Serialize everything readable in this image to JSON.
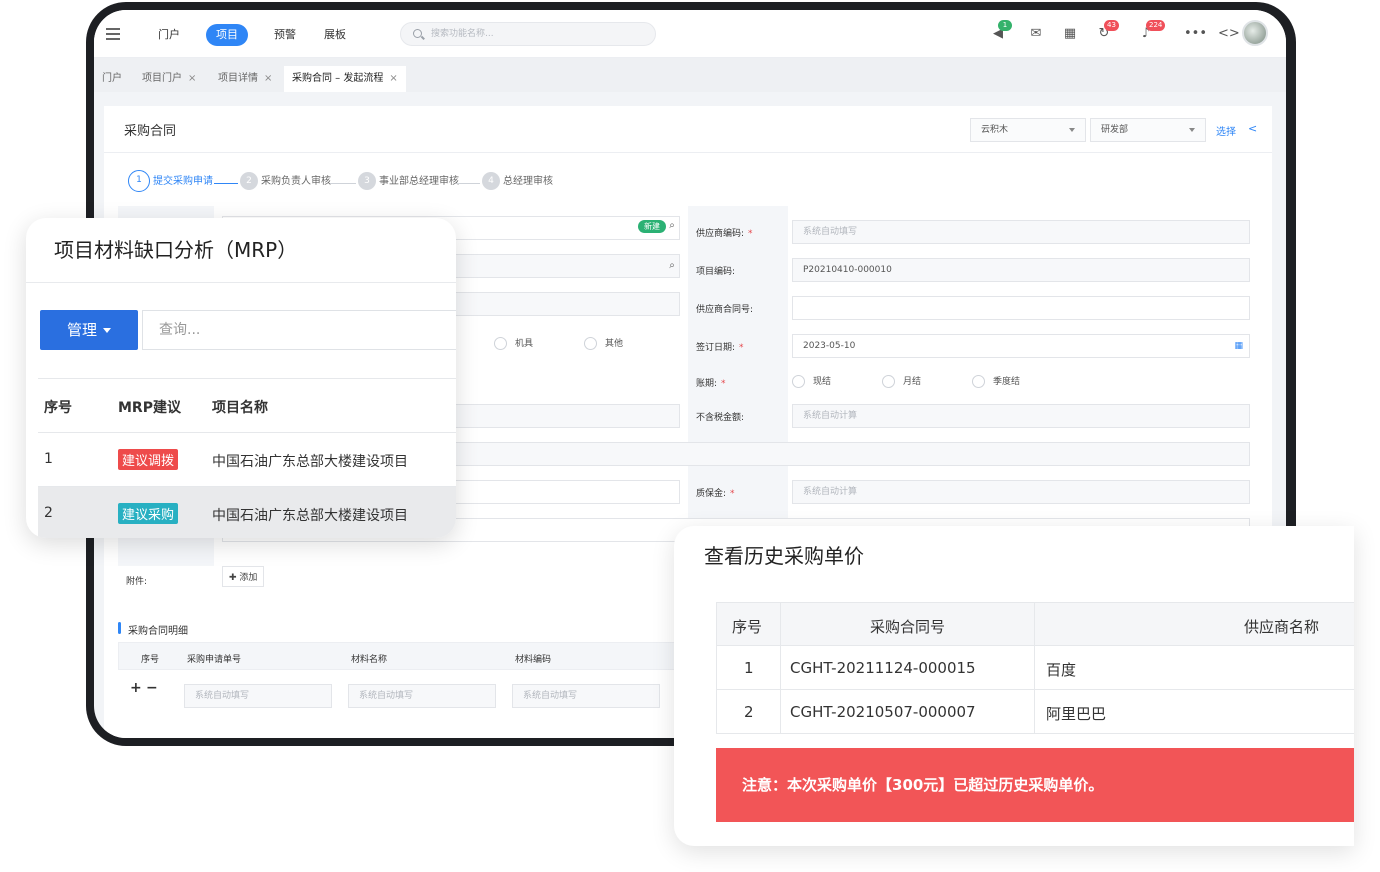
{
  "nav": {
    "items": [
      "门户",
      "项目",
      "预警",
      "展板"
    ],
    "active_index": 1,
    "search_placeholder": "搜索功能名称..."
  },
  "header_icons": {
    "announce_badge": "1",
    "refresh_badge": "43",
    "bell_badge": "224",
    "more": "•••",
    "code": "<>"
  },
  "tabs": [
    {
      "label": "门户",
      "closable": false
    },
    {
      "label": "项目门户",
      "closable": true
    },
    {
      "label": "项目详情",
      "closable": true
    },
    {
      "label": "采购合同 – 发起流程",
      "closable": true,
      "active": true
    }
  ],
  "tab_close": "×",
  "form": {
    "title": "采购合同",
    "company": "云积木",
    "department": "研发部",
    "select_link": "选择",
    "steps": [
      "提交采购申请",
      "采购负责人审核",
      "事业部总经理审核",
      "总经理审核"
    ],
    "step_numbers": [
      "1",
      "2",
      "3",
      "4"
    ],
    "new_tag": "新建",
    "supplier_code_label": "供应商编码:",
    "supplier_code_placeholder": "系统自动填写",
    "project_code_label": "项目编码:",
    "project_code_value": "P20210410-000010",
    "supplier_contract_label": "供应商合同号:",
    "sign_date_label": "签订日期:",
    "sign_date_value": "2023-05-10",
    "account_period_label": "账期:",
    "account_options": [
      "现结",
      "月结",
      "季度结"
    ],
    "type_options": [
      "机具",
      "其他"
    ],
    "amount_label": "不含税金额:",
    "amount_placeholder": "系统自动计算",
    "deposit_label": "质保金:",
    "deposit_placeholder": "系统自动计算",
    "required_mark": "*",
    "attachment_label": "附件:",
    "add_label": "添加",
    "detail_section": "采购合同明细",
    "detail_columns": [
      "序号",
      "采购申请单号",
      "材料名称",
      "材料编码"
    ],
    "detail_placeholder": "系统自动填写",
    "plus": "+",
    "minus": "−"
  },
  "mrp": {
    "title": "项目材料缺口分析（MRP）",
    "manage_button": "管理",
    "search_placeholder": "查询...",
    "columns": [
      "序号",
      "MRP建议",
      "项目名称"
    ],
    "rows": [
      {
        "no": "1",
        "tag": "建议调拨",
        "project": "中国石油广东总部大楼建设项目"
      },
      {
        "no": "2",
        "tag": "建议采购",
        "project": "中国石油广东总部大楼建设项目"
      }
    ]
  },
  "history": {
    "title": "查看历史采购单价",
    "columns": [
      "序号",
      "采购合同号",
      "供应商名称"
    ],
    "rows": [
      {
        "no": "1",
        "contract": "CGHT-20211124-000015",
        "supplier": "百度"
      },
      {
        "no": "2",
        "contract": "CGHT-20210507-000007",
        "supplier": "阿里巴巴"
      }
    ],
    "warning": "注意：本次采购单价【300元】已超过历史采购单价。"
  }
}
